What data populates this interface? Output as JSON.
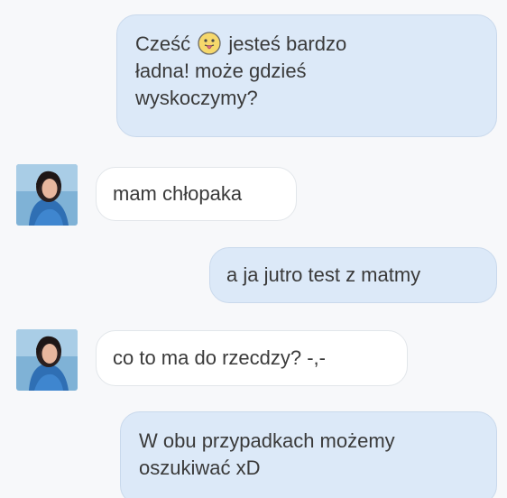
{
  "messages": [
    {
      "direction": "outgoing",
      "part1": "Cześć",
      "emoji_icon": "face-with-tongue-icon",
      "part2": "jesteś bardzo",
      "line2": "ładna! może gdzieś",
      "line3": "wyskoczymy?"
    },
    {
      "direction": "incoming",
      "text": "mam chłopaka"
    },
    {
      "direction": "outgoing",
      "text": "a ja jutro test z matmy"
    },
    {
      "direction": "incoming",
      "text": "co to ma do rzecdzy? -,-"
    },
    {
      "direction": "outgoing",
      "line1": "W obu przypadkach możemy",
      "line2": "oszukiwać xD"
    }
  ],
  "colors": {
    "outgoing_bubble": "#dce9f8",
    "incoming_bubble": "#ffffff",
    "text": "#3a3a3a",
    "background": "#f7f8fa"
  },
  "icons": {
    "avatar": "contact-avatar-photo"
  }
}
